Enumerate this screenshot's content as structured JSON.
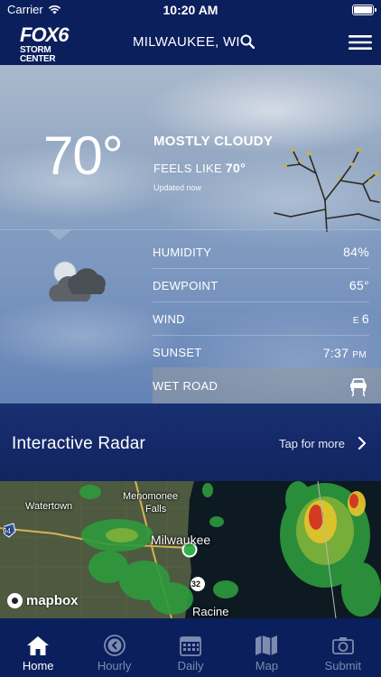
{
  "status_bar": {
    "carrier": "Carrier",
    "time": "10:20 AM"
  },
  "nav": {
    "logo_main": "FOX6",
    "logo_sub": "STORM CENTER",
    "location": "MILWAUKEE, WI"
  },
  "current": {
    "temperature": "70°",
    "condition": "MOSTLY CLOUDY",
    "feels_like_label": "FEELS LIKE",
    "feels_like_value": "70°",
    "updated": "Updated now"
  },
  "details": [
    {
      "label": "HUMIDITY",
      "value": "84%"
    },
    {
      "label": "DEWPOINT",
      "value": "65°"
    },
    {
      "label": "WIND",
      "dir": "E",
      "value": "6"
    },
    {
      "label": "SUNSET",
      "value": "7:37",
      "suffix": "PM"
    }
  ],
  "road": {
    "label": "WET ROAD"
  },
  "radar": {
    "title": "Interactive Radar",
    "tap_label": "Tap for more"
  },
  "map": {
    "labels": [
      "Watertown",
      "Menomonee",
      "Falls",
      "Milwaukee",
      "Racine"
    ],
    "route_shields": [
      "94",
      "32"
    ],
    "attribution": "mapbox"
  },
  "tabs": [
    {
      "label": "Home",
      "active": true
    },
    {
      "label": "Hourly",
      "active": false
    },
    {
      "label": "Daily",
      "active": false
    },
    {
      "label": "Map",
      "active": false
    },
    {
      "label": "Submit",
      "active": false
    }
  ],
  "colors": {
    "nav_bg": "#0b1f5c",
    "active_tab": "#ffffff",
    "inactive_tab": "#7d8bb0"
  }
}
